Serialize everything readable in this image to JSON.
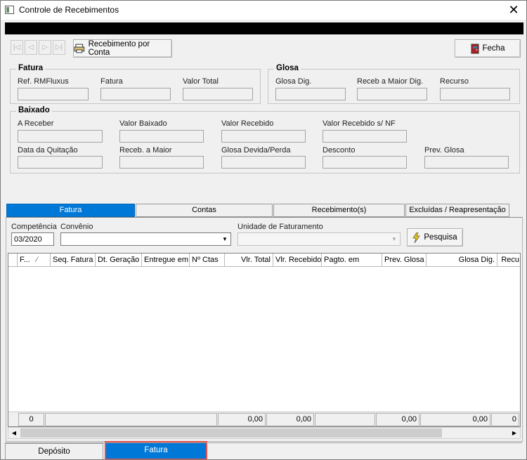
{
  "window": {
    "title": "Controle de Recebimentos",
    "close_glyph": "✕"
  },
  "toolbar": {
    "nav": [
      "|◁",
      "◁",
      "▷",
      "▷|"
    ],
    "recebimento_label": "Recebimento por Conta",
    "fecha_label": "Fecha"
  },
  "fatura_group": {
    "title": "Fatura",
    "fields": [
      "Ref. RMFluxus",
      "Fatura",
      "Valor Total"
    ]
  },
  "glosa_group": {
    "title": "Glosa",
    "fields": [
      "Glosa Dig.",
      "Receb a Maior Dig.",
      "Recurso"
    ]
  },
  "baixado_group": {
    "title": "Baixado",
    "row1": [
      "A Receber",
      "Valor Baixado",
      "Valor Recebido",
      "Valor Recebido s/ NF"
    ],
    "row2": [
      "Data da Quitação",
      "Receb. a Maior",
      "Glosa Devida/Perda",
      "Desconto",
      "Prev. Glosa"
    ]
  },
  "tabs": [
    "Fatura",
    "Contas",
    "Recebimento(s)",
    "Excluídas / Reapresentação"
  ],
  "filters": {
    "competencia_label": "Competência",
    "competencia_value": "03/2020",
    "convenio_label": "Convênio",
    "unidade_label": "Unidade de Faturamento",
    "pesquisa_label": "Pesquisa"
  },
  "grid": {
    "columns": [
      "F...",
      "Seq. Fatura",
      "Dt. Geração",
      "Entregue em",
      "Nº Ctas",
      "Vlr. Total",
      "Vlr. Recebido",
      "Pagto. em",
      "Prev. Glosa",
      "Glosa Dig.",
      "Recu"
    ],
    "sort_indicator": "∕",
    "footer": [
      "0",
      "",
      "0,00",
      "0,00",
      "",
      "0,00",
      "0,00",
      "0"
    ]
  },
  "bottom_tabs": [
    "Depósito",
    "Fatura"
  ],
  "colors": {
    "accent": "#0078d7",
    "highlight_border": "#e05050"
  }
}
